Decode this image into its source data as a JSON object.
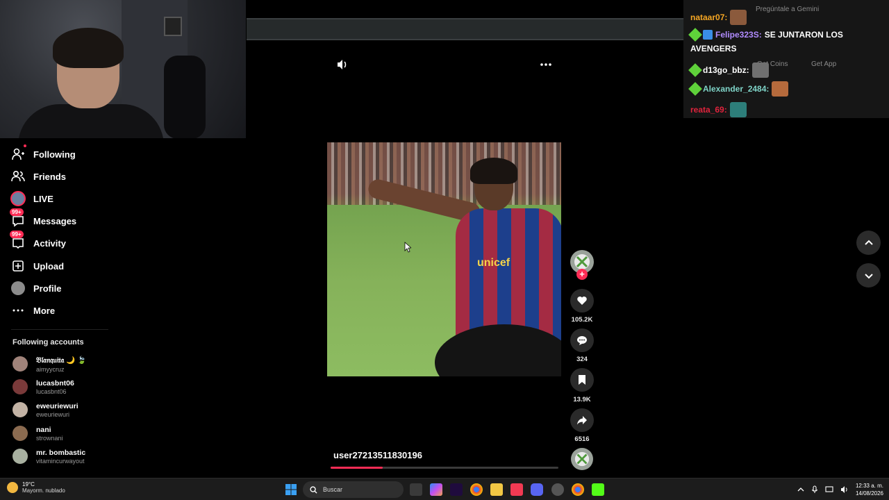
{
  "sidebar": {
    "nav": [
      {
        "label": "Following",
        "icon": "person-plus-icon"
      },
      {
        "label": "Friends",
        "icon": "people-icon"
      },
      {
        "label": "LIVE",
        "icon": "live-icon"
      },
      {
        "label": "Messages",
        "icon": "message-icon",
        "badge": "99+"
      },
      {
        "label": "Activity",
        "icon": "activity-icon",
        "badge": "99+"
      },
      {
        "label": "Upload",
        "icon": "upload-icon"
      },
      {
        "label": "Profile",
        "icon": "profile-avatar-icon"
      },
      {
        "label": "More",
        "icon": "more-dots-icon"
      }
    ],
    "following_title": "Following accounts",
    "accounts": [
      {
        "name": "𝔅𝔩𝔞𝔫𝔮𝔲𝔦𝔱𝔞 🌙 🍃",
        "username": "aimyycruz",
        "color": "#a0837a"
      },
      {
        "name": "lucasbnt06",
        "username": "lucasbnt06",
        "color": "#7a3a3a"
      },
      {
        "name": "eweuriewuri",
        "username": "eweuriewuri",
        "color": "#c2b2a4"
      },
      {
        "name": "nani",
        "username": "strownani",
        "color": "#8b6b50"
      },
      {
        "name": "mr. bombastic",
        "username": "vitamincurwayout",
        "color": "#a8b0a0"
      }
    ]
  },
  "video": {
    "author": "user27213511830196",
    "progress": 0.23,
    "sponsor": "unicef"
  },
  "actions": {
    "likes": "105.2K",
    "comments": "324",
    "saves": "13.9K",
    "shares": "6516",
    "follow_plus": "+"
  },
  "chat": {
    "messages": [
      {
        "user": "nataar07:",
        "text": "",
        "color": "#f5a623"
      },
      {
        "user": "Felipe323S:",
        "text": "SE JUNTARON LOS",
        "color": "#b18cff"
      },
      {
        "user": "",
        "text": "AVENGERS",
        "color": "#fff"
      },
      {
        "user": "d13go_bbz:",
        "text": "",
        "color": "#ffffff"
      },
      {
        "user": "Alexander_2484:",
        "text": "",
        "color": "#7fd4c8"
      },
      {
        "user": "reata_69:",
        "text": "",
        "color": "#e0233c"
      }
    ],
    "ghost_gemini": "Pregúntale a Gemini",
    "ghost_coins": "Get Coins",
    "ghost_app": "Get App"
  },
  "taskbar": {
    "temp": "19°C",
    "condition": "Mayorm. nublado",
    "search_placeholder": "Buscar",
    "time": "12:33 a. m.",
    "date": "14/08/2026"
  },
  "colors": {
    "accent": "#fe2c55",
    "background": "#000000"
  }
}
